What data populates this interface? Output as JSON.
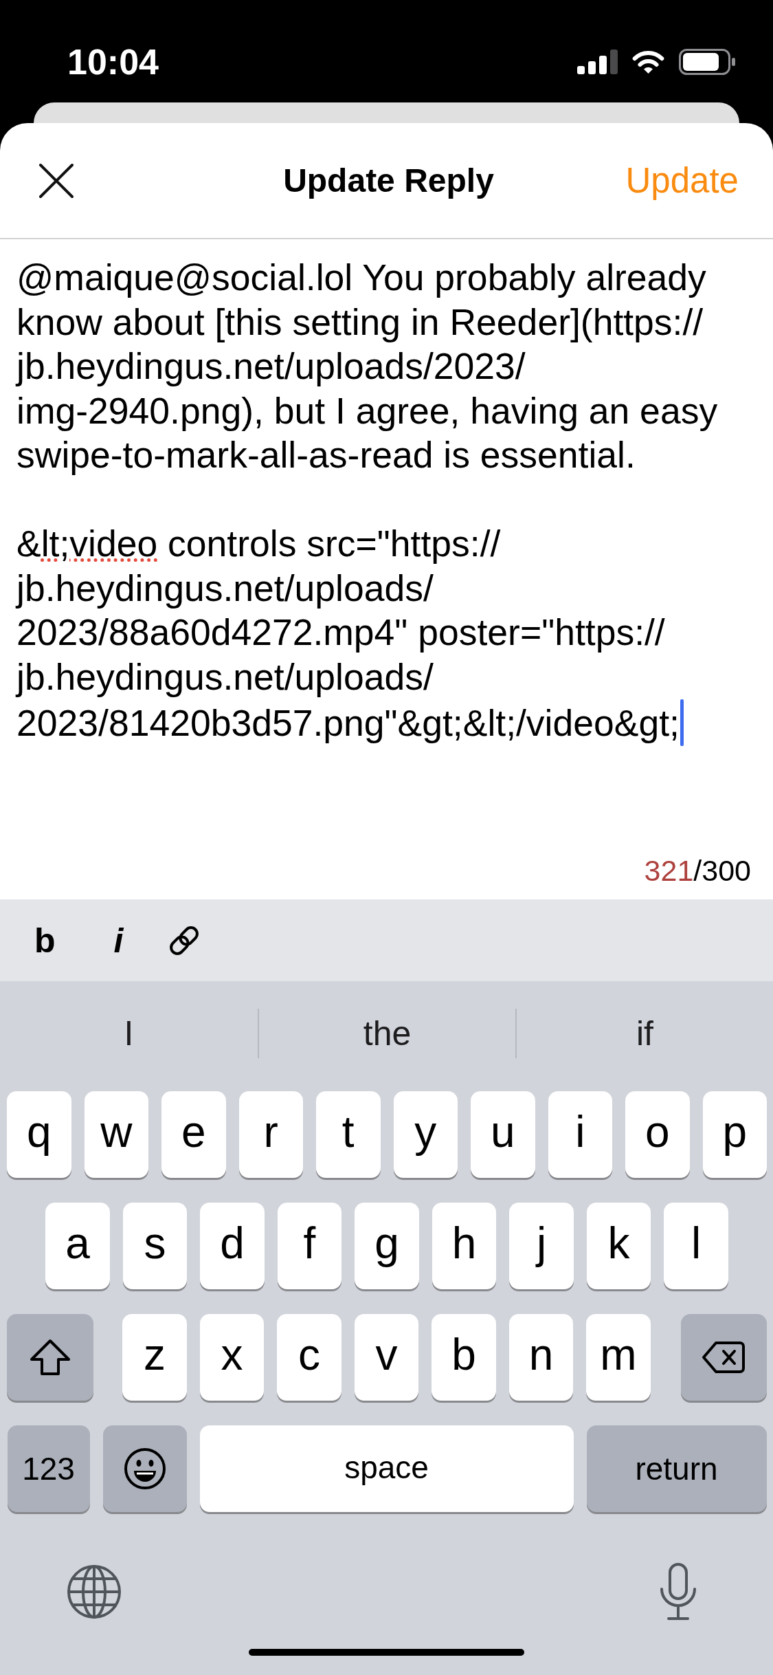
{
  "status_bar": {
    "time": "10:04"
  },
  "header": {
    "title": "Update Reply",
    "action": "Update"
  },
  "editor": {
    "segments": [
      {
        "text": "@maique@social.lol You probably already\nknow about [this setting in Reeder](https://\njb.heydingus.net/uploads/2023/\nimg-2940.png), but I agree, having an easy\nswipe-to-mark-all-as-read is essential.\n\n&",
        "misspelled": false
      },
      {
        "text": "lt;video",
        "misspelled": true
      },
      {
        "text": " controls src=\"https://\njb.heydingus.net/uploads/\n2023/88a60d4272.mp4\" poster=\"https://\njb.heydingus.net/uploads/\n2023/81420b3d57.png\"&gt;&lt;/video&gt;",
        "misspelled": false
      }
    ],
    "focused": true
  },
  "counter": {
    "count": "321",
    "limit": "/300",
    "over_limit": true
  },
  "format_toolbar": [
    {
      "kind": "bold",
      "label": "b"
    },
    {
      "kind": "italic",
      "label": "i"
    },
    {
      "kind": "link"
    }
  ],
  "keyboard": {
    "suggestions": [
      "I",
      "the",
      "if"
    ],
    "key_rows": [
      {
        "keys": [
          {
            "kind": "letter",
            "label": "q"
          },
          {
            "kind": "letter",
            "label": "w"
          },
          {
            "kind": "letter",
            "label": "e"
          },
          {
            "kind": "letter",
            "label": "r"
          },
          {
            "kind": "letter",
            "label": "t"
          },
          {
            "kind": "letter",
            "label": "y"
          },
          {
            "kind": "letter",
            "label": "u"
          },
          {
            "kind": "letter",
            "label": "i"
          },
          {
            "kind": "letter",
            "label": "o"
          },
          {
            "kind": "letter",
            "label": "p"
          }
        ]
      },
      {
        "keys": [
          {
            "kind": "letter",
            "label": "a"
          },
          {
            "kind": "letter",
            "label": "s"
          },
          {
            "kind": "letter",
            "label": "d"
          },
          {
            "kind": "letter",
            "label": "f"
          },
          {
            "kind": "letter",
            "label": "g"
          },
          {
            "kind": "letter",
            "label": "h"
          },
          {
            "kind": "letter",
            "label": "j"
          },
          {
            "kind": "letter",
            "label": "k"
          },
          {
            "kind": "letter",
            "label": "l"
          }
        ]
      },
      {
        "keys": [
          {
            "kind": "shift",
            "on": false
          },
          {
            "kind": "letter",
            "label": "z"
          },
          {
            "kind": "letter",
            "label": "x"
          },
          {
            "kind": "letter",
            "label": "c"
          },
          {
            "kind": "letter",
            "label": "v"
          },
          {
            "kind": "letter",
            "label": "b"
          },
          {
            "kind": "letter",
            "label": "n"
          },
          {
            "kind": "letter",
            "label": "m"
          },
          {
            "kind": "delete"
          }
        ]
      },
      {
        "keys": [
          {
            "kind": "numbers",
            "label": "123"
          },
          {
            "kind": "emoji"
          },
          {
            "kind": "space",
            "label": "space"
          },
          {
            "kind": "return",
            "label": "return"
          }
        ]
      }
    ]
  }
}
